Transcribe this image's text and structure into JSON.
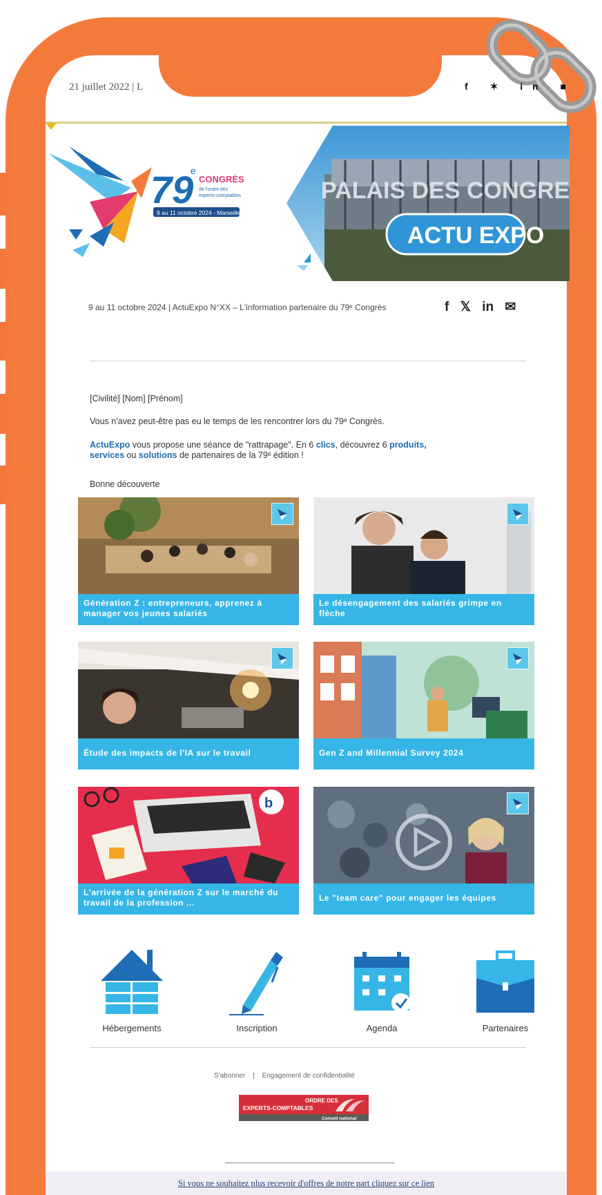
{
  "header": {
    "date_line": "21 juillet 2022 | L",
    "social": [
      "f",
      "✶",
      "in",
      "■"
    ]
  },
  "banner": {
    "congress_number": "79",
    "congress_sup": "e",
    "congress_title": "CONGRÈS",
    "congress_sub1": "de l'ordre des",
    "congress_sub2": "experts-comptables",
    "congress_dates": "9 au 11 octobre 2024 - Marseille",
    "venue_sign": "PALAIS DES CONGRES",
    "badge": "ACTU EXPO"
  },
  "intro": {
    "mini_line": "9 au 11 octobre 2024 | ActuExpo N°XX – L'information partenaire du 79ᵉ Congrès",
    "social": [
      "f",
      "𝕏",
      "in",
      "✉"
    ]
  },
  "message": {
    "greeting": "[Civilité] [Nom] [Prénom]",
    "line1": "Vous n'avez peut-être pas eu le temps de les rencontrer lors du 79ᵉ Congrès.",
    "l2_brand": "ActuExpo",
    "l2_a": " vous propose une séance de \"rattrapage\". En 6 ",
    "l2_clics": "clics",
    "l2_b": ", découvrez 6 ",
    "l2_produits": "produits,",
    "l2_services": "services",
    "l2_c": " ou ",
    "l2_solutions": "solutions",
    "l2_d": " de partenaires de la 79ᵉ édition !",
    "closing": "Bonne découverte"
  },
  "cards": [
    {
      "caption": "Génération Z : entrepreneurs, apprenez à manager vos jeunes salariés"
    },
    {
      "caption": "Le désengagement des salariés grimpe en flèche"
    },
    {
      "caption": "Étude des impacts de l'IA sur le travail"
    },
    {
      "caption": "Gen Z and Millennial Survey 2024"
    },
    {
      "caption": "L'arrivée de la génération Z sur le marché du travail de la profession ..."
    },
    {
      "caption": "Le \"team care\" pour engager les équipes"
    }
  ],
  "quicklinks": [
    {
      "label": "Hébergements",
      "icon": "house-icon"
    },
    {
      "label": "Inscription",
      "icon": "pen-icon"
    },
    {
      "label": "Agenda",
      "icon": "calendar-icon"
    },
    {
      "label": "Partenaires",
      "icon": "briefcase-icon"
    }
  ],
  "footer": {
    "subscribe": "S'abonner",
    "separator": "|",
    "privacy": "Engagement de confidentialité",
    "logo_line1": "ORDRE DES",
    "logo_line2": "EXPERTS-COMPTABLES",
    "logo_line3": "Conseil national",
    "unsubscribe": "Si vous ne souhaitez plus recevoir d'offres de notre part cliquez sur ce lien"
  },
  "colors": {
    "frame": "#f47a3b",
    "accent_blue": "#36b6e6",
    "link_blue": "#1f6bb2"
  }
}
